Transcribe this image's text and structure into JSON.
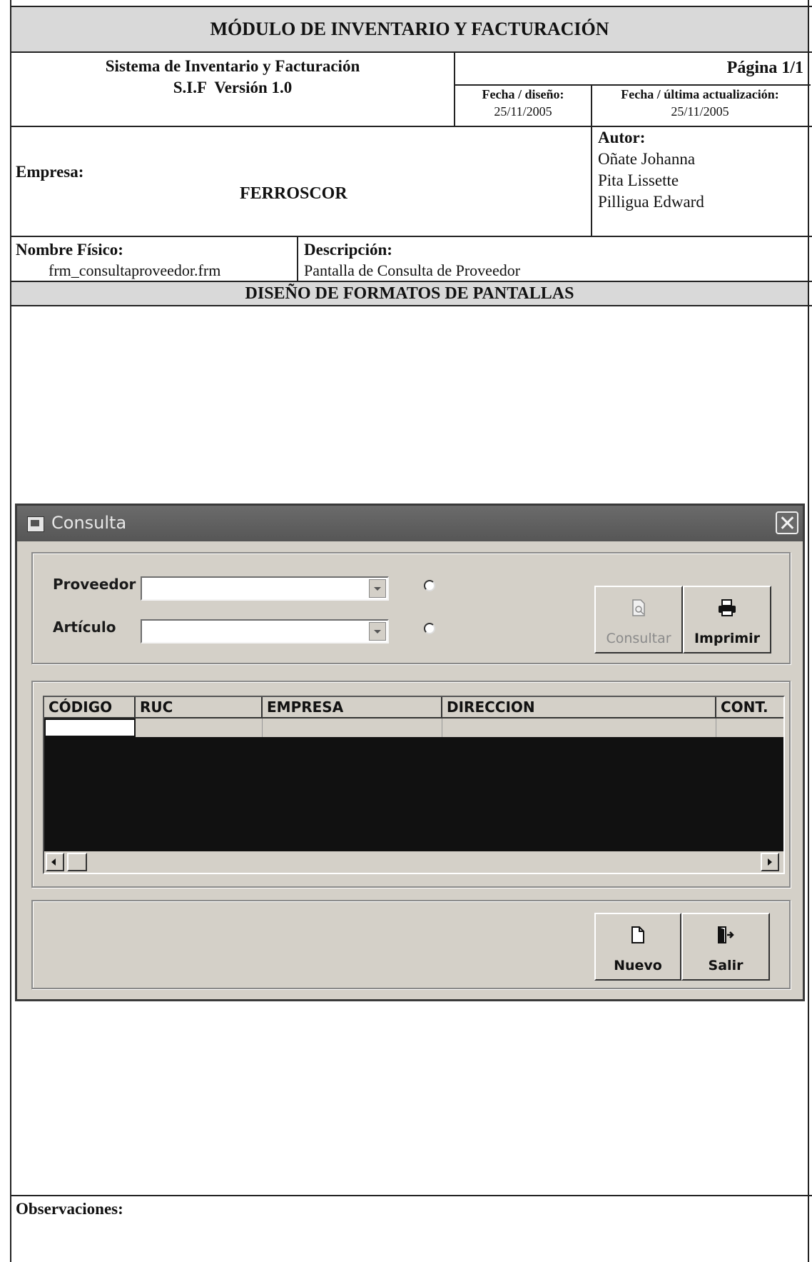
{
  "document": {
    "module_title": "MÓDULO DE INVENTARIO Y FACTURACIÓN",
    "system_name": "Sistema de Inventario y Facturación",
    "system_version": "S.I.F  Versión 1.0",
    "page_label": "Página 1/1",
    "design_date_label": "Fecha / diseño:",
    "design_date": "25/11/2005",
    "update_date_label": "Fecha / última actualización:",
    "update_date": "25/11/2005",
    "company_label": "Empresa:",
    "company_name": "FERROSCOR",
    "author_label": "Autor:",
    "authors": [
      "Oñate Johanna",
      "Pita Lissette",
      "Pilligua Edward"
    ],
    "physical_name_label": "Nombre Físico:",
    "physical_name": "frm_consultaproveedor.frm",
    "description_label": "Descripción:",
    "description": "Pantalla de Consulta de Proveedor",
    "section_title": "DISEÑO DE FORMATOS DE PANTALLAS",
    "observations_label": "Observaciones:"
  },
  "dialog": {
    "title": "Consulta",
    "filters": {
      "provider_label": "Proveedor",
      "provider_value": "",
      "article_label": "Artículo",
      "article_value": ""
    },
    "buttons": {
      "consultar": "Consultar",
      "imprimir": "Imprimir",
      "nuevo": "Nuevo",
      "salir": "Salir"
    },
    "grid": {
      "columns": [
        "CÓDIGO",
        "RUC",
        "EMPRESA",
        "DIRECCION",
        "CONT."
      ],
      "rows": [
        [
          "",
          "",
          "",
          "",
          ""
        ]
      ]
    },
    "icons": {
      "title": "form-icon",
      "consultar": "search-document-icon",
      "imprimir": "printer-icon",
      "nuevo": "new-document-icon",
      "salir": "exit-door-icon",
      "close": "close-icon"
    },
    "colors": {
      "window_face": "#d4d0c8",
      "title_bar": "#5e5e5e",
      "banner": "#d9d9d9"
    }
  }
}
